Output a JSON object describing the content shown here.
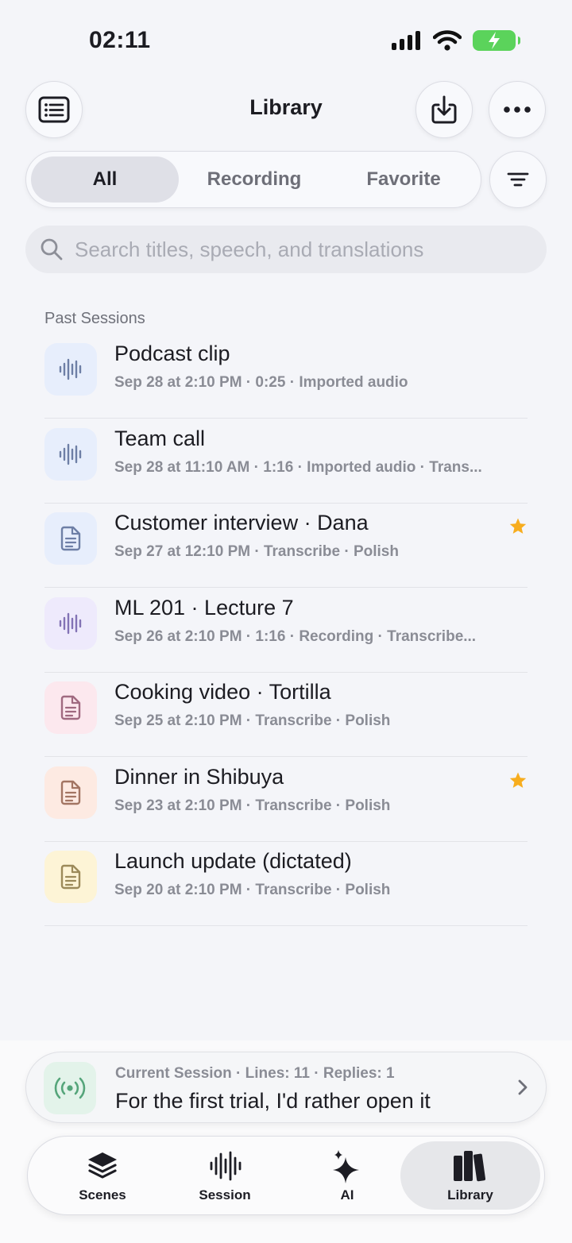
{
  "status_bar": {
    "time": "02:11"
  },
  "header": {
    "title": "Library"
  },
  "filter_tabs": [
    {
      "label": "All",
      "active": true
    },
    {
      "label": "Recording",
      "active": false
    },
    {
      "label": "Favorite",
      "active": false
    }
  ],
  "search": {
    "placeholder": "Search titles, speech, and translations"
  },
  "section": {
    "title": "Past Sessions"
  },
  "sessions": [
    {
      "title": "Podcast clip",
      "subtitle": "Sep 28 at 2:10 PM · 0:25 · Imported audio",
      "icon": "waveform-icon",
      "icon_bg": "#e7eefc",
      "icon_color": "#6e7fa6",
      "favorite": false
    },
    {
      "title": "Team call",
      "subtitle": "Sep 28 at 11:10 AM · 1:16 · Imported audio · Trans...",
      "icon": "waveform-icon",
      "icon_bg": "#e7eefc",
      "icon_color": "#6e7fa6",
      "favorite": false
    },
    {
      "title": "Customer interview · Dana",
      "subtitle": "Sep 27 at 12:10 PM · Transcribe · Polish",
      "icon": "document-icon",
      "icon_bg": "#e7eefc",
      "icon_color": "#6e7fa6",
      "favorite": true
    },
    {
      "title": "ML 201 · Lecture 7",
      "subtitle": "Sep 26 at 2:10 PM · 1:16 · Recording · Transcribe...",
      "icon": "waveform-icon",
      "icon_bg": "#eeeafc",
      "icon_color": "#8373b5",
      "favorite": false
    },
    {
      "title": "Cooking video · Tortilla",
      "subtitle": "Sep 25 at 2:10 PM · Transcribe · Polish",
      "icon": "document-icon",
      "icon_bg": "#fce8ee",
      "icon_color": "#a06a80",
      "favorite": false
    },
    {
      "title": "Dinner in Shibuya",
      "subtitle": "Sep 23 at 2:10 PM · Transcribe · Polish",
      "icon": "document-icon",
      "icon_bg": "#fdeae2",
      "icon_color": "#a37563",
      "favorite": true
    },
    {
      "title": "Launch update (dictated)",
      "subtitle": "Sep 20 at 2:10 PM · Transcribe · Polish",
      "icon": "document-icon",
      "icon_bg": "#fdf4d6",
      "icon_color": "#9c8a5a",
      "favorite": false
    }
  ],
  "current_session": {
    "meta": "Current Session · Lines: 11 · Replies: 1",
    "text": "For the first trial, I'd rather open it"
  },
  "tab_bar": [
    {
      "label": "Scenes",
      "icon": "layers-icon",
      "active": false
    },
    {
      "label": "Session",
      "icon": "waveform-icon",
      "active": false
    },
    {
      "label": "AI",
      "icon": "sparkles-icon",
      "active": false
    },
    {
      "label": "Library",
      "icon": "books-icon",
      "active": true
    }
  ],
  "colors": {
    "favorite_star": "#f7ad1e",
    "battery": "#5bd35b"
  }
}
